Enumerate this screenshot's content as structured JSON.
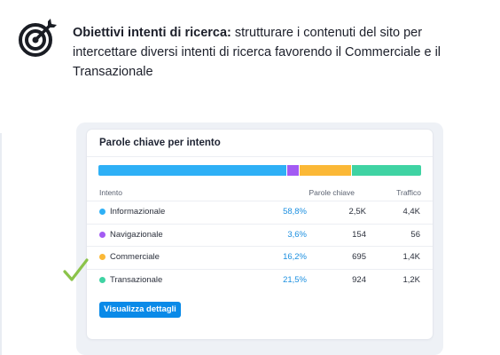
{
  "headline": {
    "bold": "Obiettivi intenti di ricerca:",
    "text": "strutturare i contenuti del sito per intercettare diversi intenti di ricerca favorendo il Commerciale e il Transazionale"
  },
  "icons": {
    "target": "target-icon",
    "check": "check-icon"
  },
  "card": {
    "title": "Parole chiave per intento",
    "columns": {
      "intent": "Intento",
      "keywords": "Parole chiave",
      "traffic": "Traffico"
    },
    "rows": [
      {
        "label": "Informazionale",
        "percent": "58,8%",
        "keywords": "2,5K",
        "traffic": "4,4K",
        "color": "#2eb0f6",
        "share": 58.8
      },
      {
        "label": "Navigazionale",
        "percent": "3,6%",
        "keywords": "154",
        "traffic": "56",
        "color": "#a35bf3",
        "share": 3.6
      },
      {
        "label": "Commerciale",
        "percent": "16,2%",
        "keywords": "695",
        "traffic": "1,4K",
        "color": "#fbb836",
        "share": 16.2
      },
      {
        "label": "Transazionale",
        "percent": "21,5%",
        "keywords": "924",
        "traffic": "1,2K",
        "color": "#3fd3a3",
        "share": 21.5
      }
    ],
    "button_label": "Visualizza dettagli"
  },
  "colors": {
    "accent": "#0a8ae8",
    "check": "#8bc34a"
  }
}
